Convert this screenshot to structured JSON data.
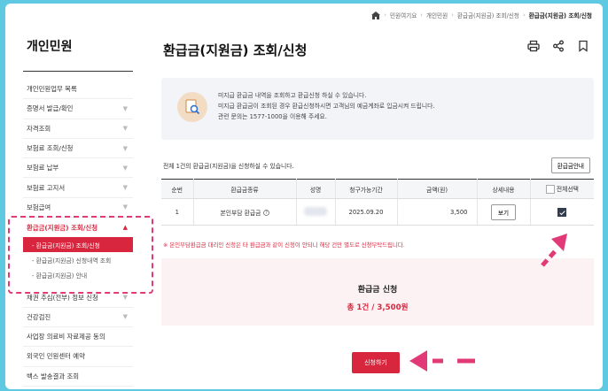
{
  "sidebar": {
    "title": "개인민원",
    "items": [
      {
        "label": "개인민원업무 목록",
        "chev": ""
      },
      {
        "label": "증명서 발급/확인",
        "chev": "▼"
      },
      {
        "label": "자격조회",
        "chev": "▼"
      },
      {
        "label": "보험료 조회/신청",
        "chev": "▼"
      },
      {
        "label": "보험료 납부",
        "chev": "▼"
      },
      {
        "label": "보험료 고지서",
        "chev": "▼"
      },
      {
        "label": "보험급여",
        "chev": "▼"
      }
    ],
    "active_item": {
      "label": "환급금(지원금) 조회/신청",
      "chev": "▲"
    },
    "sub_items": [
      {
        "label": "- 환급금(지원금) 조회/신청"
      },
      {
        "label": "- 환급금(지원금) 신청내역 조회"
      },
      {
        "label": "- 환급금(지원금) 안내"
      }
    ],
    "after_items": [
      {
        "label": "채권 추심(전부) 정보 신청",
        "chev": "▼"
      },
      {
        "label": "건강검진",
        "chev": "▼"
      },
      {
        "label": "사업장 의료비 자료제공 동의",
        "chev": ""
      },
      {
        "label": "외국인 민원센터 예약",
        "chev": ""
      },
      {
        "label": "백스 발송결과 조회",
        "chev": ""
      }
    ]
  },
  "breadcrumb": {
    "items": [
      "민원여기요",
      "개인민원",
      "환급금(지원금) 조회/신청"
    ],
    "current": "환급금(지원금) 조회/신청"
  },
  "page": {
    "title": "환급금(지원금) 조회/신청"
  },
  "icons": {
    "print": "print-icon",
    "share": "share-icon",
    "bookmark": "bookmark-icon",
    "home": "home-icon"
  },
  "info": {
    "lines": [
      "미지급 환급금 내역을 조회하고 환급신청 하실 수 있습니다.",
      "미지급 환급금이 조회된 경우 환급신청하시면 고객님의 예금계좌로 입금시켜 드립니다.",
      "관련 문의는 1577-1000을 이용해 주세요."
    ]
  },
  "list": {
    "count_text": "전체 1건의 환급금(지원금)을 신청하실 수 있습니다.",
    "guide_label": "환급금안내",
    "headers": [
      "순번",
      "환급금종류",
      "성명",
      "청구가능기간",
      "금액(원)",
      "상세내용",
      "전체선택"
    ],
    "rows": [
      {
        "no": "1",
        "type": "본인부담 환급금",
        "period": "2025.09.20",
        "amount": "3,500",
        "view_label": "보기",
        "checked": true
      }
    ]
  },
  "notice": "※ 본인부담환급금 대리인 신청은 타 환급금과 같이 신청이 안되니 해당 건만 별도로 신청부탁드립니다.",
  "summary": {
    "label": "환급금 신청",
    "amount": "총 1건 / 3,500원"
  },
  "apply_label": "신청하기",
  "colors": {
    "accent": "#d7263d",
    "highlight": "#e23a76",
    "background": "#5ec9e0"
  }
}
